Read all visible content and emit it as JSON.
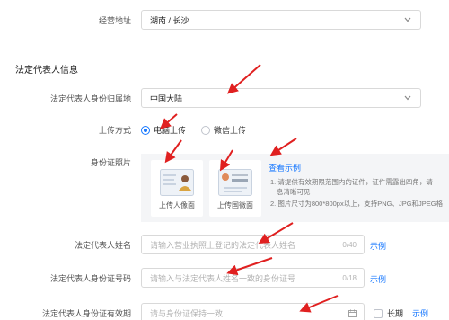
{
  "business_address": {
    "label": "经营地址",
    "value": "湖南 / 长沙"
  },
  "section_title": "法定代表人信息",
  "id_region": {
    "label": "法定代表人身份归属地",
    "value": "中国大陆"
  },
  "upload_method": {
    "label": "上传方式",
    "options": [
      "电脑上传",
      "微信上传"
    ],
    "selected": "电脑上传"
  },
  "id_photo": {
    "label": "身份证照片",
    "cards": [
      "上传人像面",
      "上传国徽面"
    ],
    "example_link": "查看示例",
    "notes": [
      "1. 请提供有效期限范围内的证件，证件需露出四角，请",
      "息清晰可见",
      "2. 图片尺寸为800*800px以上，支持PNG、JPG和JPEG格"
    ]
  },
  "legal_name": {
    "label": "法定代表人姓名",
    "placeholder": "请输入营业执照上登记的法定代表人姓名",
    "count": "0/40",
    "example": "示例"
  },
  "legal_id_number": {
    "label": "法定代表人身份证号码",
    "placeholder": "请输入与法定代表人姓名一致的身份证号",
    "count": "0/18",
    "example": "示例"
  },
  "legal_id_validity": {
    "label": "法定代表人身份证有效期",
    "placeholder": "请与身份证保持一致",
    "long_term": "长期",
    "example": "示例"
  },
  "colors": {
    "accent": "#1677ff",
    "annotation": "#e02020"
  }
}
